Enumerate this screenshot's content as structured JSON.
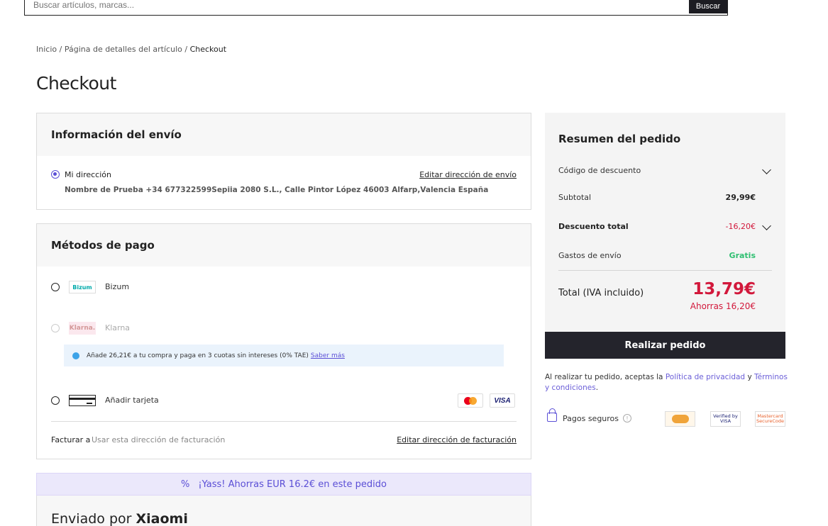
{
  "search": {
    "placeholder": "Buscar artículos, marcas...",
    "button_label": "Buscar"
  },
  "breadcrumb": {
    "items": [
      "Inicio",
      "Página de detalles del artículo"
    ],
    "separator": "/",
    "current": "Checkout"
  },
  "page_title": "Checkout",
  "shipping": {
    "title": "Información del envío",
    "address_label": "Mi dirección",
    "address_selected": true,
    "edit_label": "Editar dirección de envío",
    "address_text": "Nombre de Prueba +34 677322599Sepiia 2080 S.L., Calle Pintor López 46003 Alfarp,Valencia España"
  },
  "payment": {
    "title": "Métodos de pago",
    "methods": [
      {
        "name": "Bizum",
        "logo_text": "Bizum",
        "icon": "bizum-logo"
      },
      {
        "name": "Klarna",
        "logo_text": "Klarna.",
        "icon": "klarna-logo",
        "disabled": true
      },
      {
        "name": "Añadir tarjeta",
        "icon": "card-icon"
      }
    ],
    "klarna_info": {
      "text": "Añade 26,21€ a tu compra y paga en 3 cuotas sin intereses (0% TAE)",
      "link": "Saber más"
    },
    "card_brands": [
      "mastercard",
      "VISA"
    ],
    "billing_label": "Facturar a",
    "billing_value": "Usar esta dirección de facturación",
    "billing_edit": "Editar dirección de facturación"
  },
  "savings_banner": "¡Yass! Ahorras EUR 16.2€ en este pedido",
  "shipped_by": {
    "prefix": "Enviado por",
    "seller": "Xiaomi"
  },
  "summary": {
    "title": "Resumen del pedido",
    "discount_code_label": "Código de descuento",
    "subtotal_label": "Subtotal",
    "subtotal_value": "29,99€",
    "discount_total_label": "Descuento total",
    "discount_total_value": "-16,20€",
    "shipping_label": "Gastos de envío",
    "shipping_value": "Gratis",
    "total_label": "Total (IVA incluido)",
    "total_value": "13,79€",
    "savings": "Ahorras 16,20€"
  },
  "order_button": "Realizar pedido",
  "terms": {
    "prefix": "Al realizar tu pedido, aceptas la",
    "privacy_link": "Política de privacidad",
    "conjunction": "y",
    "terms_link": "Términos y condiciones",
    "suffix": "."
  },
  "secure_payments": {
    "label": "Pagos seguros",
    "badges": [
      "secure-seal",
      "Verified by VISA",
      "Mastercard SecureCode"
    ]
  },
  "colors": {
    "accent": "#5b4fd6",
    "price_red": "#d2183b",
    "free_green": "#2fbf71",
    "dark_button": "#24242c"
  }
}
